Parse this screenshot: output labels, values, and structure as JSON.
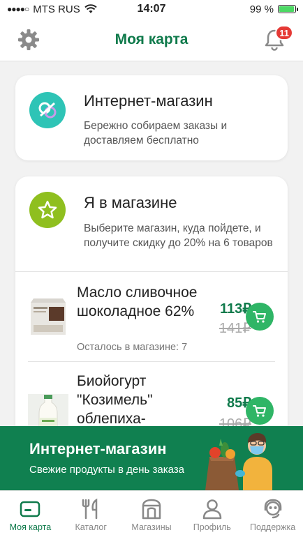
{
  "status_bar": {
    "carrier": "MTS RUS",
    "time": "14:07",
    "battery": "99 %"
  },
  "header": {
    "title": "Моя карта",
    "notification_count": "11"
  },
  "online_card": {
    "title": "Интернет-магазин",
    "description": "Бережно собираем заказы и доставляем бесплатно"
  },
  "store_card": {
    "title": "Я в магазине",
    "description": "Выберите магазин, куда пойдете, и получите скидку до 20% на 6 товаров",
    "products": [
      {
        "name": "Масло сливочное шоколадное 62%",
        "price": "113₽",
        "old_price": "141₽",
        "stock": "Осталось в магазине: 7"
      },
      {
        "name": "Биойогурт \"Козимель\" облепиха-",
        "price": "85₽",
        "old_price": "106₽",
        "stock": ""
      }
    ]
  },
  "banner": {
    "title": "Интернет-магазин",
    "subtitle": "Свежие продукты в день заказа"
  },
  "tabbar": {
    "items": [
      {
        "label": "Моя карта",
        "icon": "card-icon",
        "active": true
      },
      {
        "label": "Каталог",
        "icon": "cutlery-icon",
        "active": false
      },
      {
        "label": "Магазины",
        "icon": "store-icon",
        "active": false
      },
      {
        "label": "Профиль",
        "icon": "profile-icon",
        "active": false
      },
      {
        "label": "Поддержка",
        "icon": "support-icon",
        "active": false
      }
    ]
  },
  "colors": {
    "brand_green": "#0f7a4b",
    "banner_green": "#108050",
    "cart_green": "#2fb566",
    "badge_red": "#e53935"
  }
}
